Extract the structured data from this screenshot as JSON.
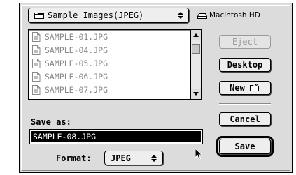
{
  "folder_popup": {
    "label": "Sample Images(JPEG)",
    "icon": "folder-icon"
  },
  "disk": {
    "label": "Macintosh HD",
    "icon": "hard-disk-icon"
  },
  "file_list": {
    "items": [
      {
        "name": "SAMPLE-01.JPG",
        "icon": "document-icon"
      },
      {
        "name": "SAMPLE-04.JPG",
        "icon": "document-icon"
      },
      {
        "name": "SAMPLE-05.JPG",
        "icon": "document-icon"
      },
      {
        "name": "SAMPLE-06.JPG",
        "icon": "document-icon"
      },
      {
        "name": "SAMPLE-07.JPG",
        "icon": "document-icon"
      }
    ]
  },
  "buttons": {
    "eject": "Eject",
    "desktop": "Desktop",
    "new": "New",
    "cancel": "Cancel",
    "save": "Save"
  },
  "save_as": {
    "label": "Save as:",
    "value": "SAMPLE-08.JPG"
  },
  "format": {
    "label": "Format:",
    "value": "JPEG"
  }
}
